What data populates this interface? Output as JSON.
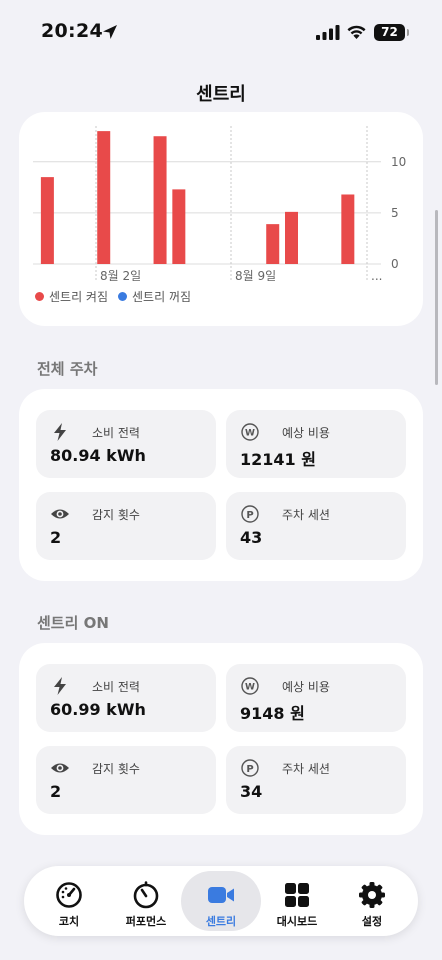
{
  "status_bar": {
    "time": "20:24",
    "battery": "72"
  },
  "nav": {
    "title": "센트리"
  },
  "chart_data": {
    "type": "bar",
    "categories": [
      "",
      "8월 2일",
      "",
      "",
      "",
      "",
      "",
      "8월 9일",
      "",
      "",
      "",
      "..."
    ],
    "series": [
      {
        "name": "센트리 켜짐",
        "values": [
          8.5,
          0,
          0,
          13,
          0,
          0,
          12.5,
          7.3,
          0,
          0,
          0,
          0,
          3.9,
          5.1,
          0,
          0,
          6.8,
          0
        ]
      }
    ],
    "x_labels": [
      "8월 2일",
      "8월 9일",
      "..."
    ],
    "y_ticks": [
      "10",
      "5",
      "0"
    ],
    "ylim": [
      0,
      13.5
    ],
    "legend": [
      "센트리 켜짐",
      "센트리 꺼짐"
    ],
    "colors": {
      "on": "#e84a4a",
      "off": "#3a7be0"
    }
  },
  "total": {
    "title": "전체 주차",
    "power_label": "소비 전력",
    "power_value": "80.94 kWh",
    "cost_label": "예상 비용",
    "cost_value": "12141 원",
    "detect_label": "감지 횟수",
    "detect_value": "2",
    "session_label": "주차 세션",
    "session_value": "43"
  },
  "sentry_on": {
    "title": "센트리 ON",
    "power_label": "소비 전력",
    "power_value": "60.99 kWh",
    "cost_label": "예상 비용",
    "cost_value": "9148 원",
    "detect_label": "감지 횟수",
    "detect_value": "2",
    "session_label": "주차 세션",
    "session_value": "34"
  },
  "tabs": [
    {
      "label": "코치",
      "icon": "gauge-icon"
    },
    {
      "label": "퍼포먼스",
      "icon": "timer-icon"
    },
    {
      "label": "센트리",
      "icon": "video-icon",
      "active": true
    },
    {
      "label": "대시보드",
      "icon": "grid-icon"
    },
    {
      "label": "설정",
      "icon": "gear-icon"
    }
  ]
}
